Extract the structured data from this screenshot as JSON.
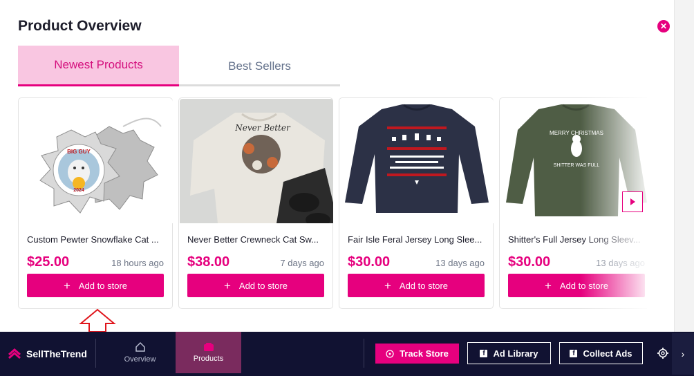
{
  "panel": {
    "title": "Product Overview",
    "close_icon": "close-icon"
  },
  "tabs": [
    {
      "label": "Newest Products",
      "active": true
    },
    {
      "label": "Best Sellers",
      "active": false
    }
  ],
  "products": [
    {
      "name": "Custom Pewter Snowflake Cat ...",
      "price": "$25.00",
      "age": "18 hours ago",
      "button": "Add to store"
    },
    {
      "name": "Never Better Crewneck Cat Sw...",
      "price": "$38.00",
      "age": "7 days ago",
      "button": "Add to store"
    },
    {
      "name": "Fair Isle Feral Jersey Long Slee...",
      "price": "$30.00",
      "age": "13 days ago",
      "button": "Add to store"
    },
    {
      "name": "Shitter's Full Jersey Long Sleev...",
      "price": "$30.00",
      "age": "13 days ago",
      "button": "Add to store"
    }
  ],
  "product_images": {
    "ornament_text_top": "BIG GUY",
    "ornament_text_bottom": "2024",
    "crewneck_text": "Never Better",
    "sweater_text_top": "MERRY CHRISTMAS",
    "sweater_text_bottom": "SHITTER WAS FULL"
  },
  "bottombar": {
    "logo_text": "SellTheTrend",
    "nav": [
      {
        "label": "Overview",
        "icon": "home-icon",
        "active": false
      },
      {
        "label": "Products",
        "icon": "products-icon",
        "active": true
      }
    ],
    "track_store": "Track Store",
    "ad_library": "Ad Library",
    "collect_ads": "Collect Ads",
    "settings_icon": "gear-icon",
    "chevron_icon": "chevron-right-icon"
  },
  "colors": {
    "accent": "#e6007e",
    "tab_active_bg": "#f9c6e1",
    "bar_bg": "#111232",
    "nav_active_bg": "#7a2b5e"
  }
}
